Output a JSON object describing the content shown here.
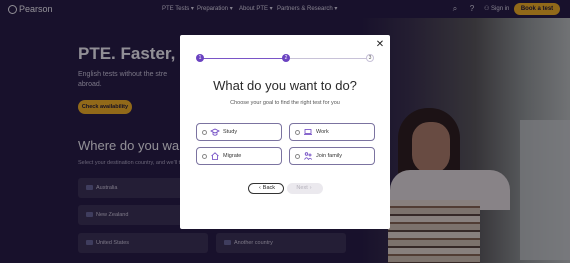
{
  "header": {
    "logo_text": "Pearson",
    "nav": [
      "PTE Tests",
      "Preparation",
      "About PTE",
      "Partners & Research"
    ],
    "sign_in": "Sign in",
    "book_button": "Book a test"
  },
  "hero": {
    "title": "PTE. Faster, fa",
    "subtitle": "English tests without the stre abroad.",
    "cta": "Check availability"
  },
  "destination": {
    "title": "Where do you wa",
    "subtitle": "Select your destination country, and we'll t",
    "countries": [
      "Australia",
      "New Zealand",
      "United States",
      "Another country"
    ]
  },
  "modal": {
    "steps": [
      "1",
      "2",
      "3"
    ],
    "current_step": 2,
    "title": "What do you want to do?",
    "subtitle": "Choose your goal to find the right test for you",
    "options": [
      {
        "label": "Study",
        "icon": "graduation-icon"
      },
      {
        "label": "Work",
        "icon": "laptop-icon"
      },
      {
        "label": "Migrate",
        "icon": "house-icon"
      },
      {
        "label": "Join family",
        "icon": "family-icon"
      }
    ],
    "back_label": "Back",
    "next_label": "Next",
    "close_glyph": "✕"
  },
  "colors": {
    "brand_purple": "#6b43c1",
    "accent_yellow": "#ffbb1c",
    "background_dark": "#231a3e"
  }
}
